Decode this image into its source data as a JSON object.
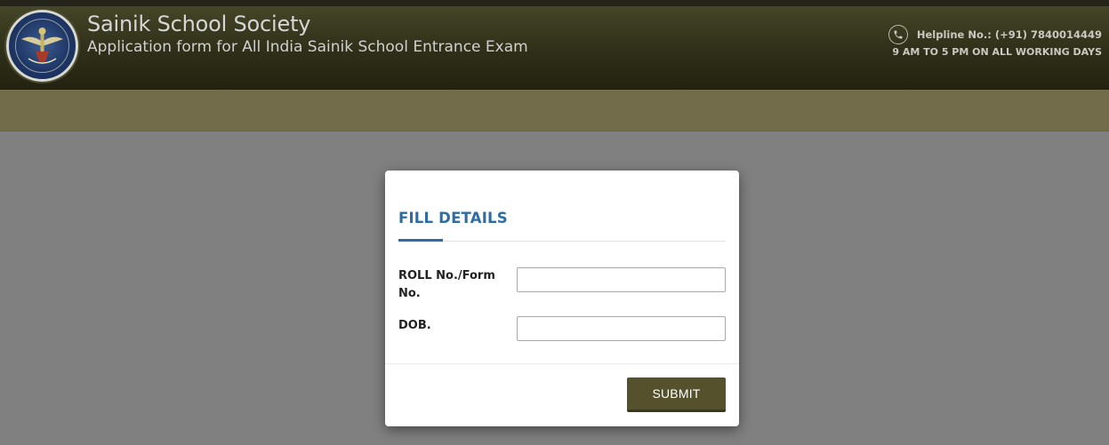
{
  "header": {
    "title": "Sainik School Society",
    "subtitle": "Application form for All India Sainik School Entrance Exam",
    "helpline": "Helpline No.: (+91) 7840014449",
    "hours": "9 AM TO 5 PM ON ALL WORKING DAYS",
    "logo_icon": "school-emblem-icon",
    "phone_icon": "phone-icon"
  },
  "modal": {
    "title": "FILL DETAILS",
    "fields": [
      {
        "label": "ROLL No./Form No.",
        "value": "",
        "placeholder": ""
      },
      {
        "label": "DOB.",
        "value": "",
        "placeholder": ""
      }
    ],
    "submit_label": "SUBMIT"
  },
  "colors": {
    "header_dark": "#2f2f19",
    "subbar": "#736c4a",
    "page_background": "#808080",
    "accent_blue": "#2e6da4",
    "button": "#54512c"
  }
}
